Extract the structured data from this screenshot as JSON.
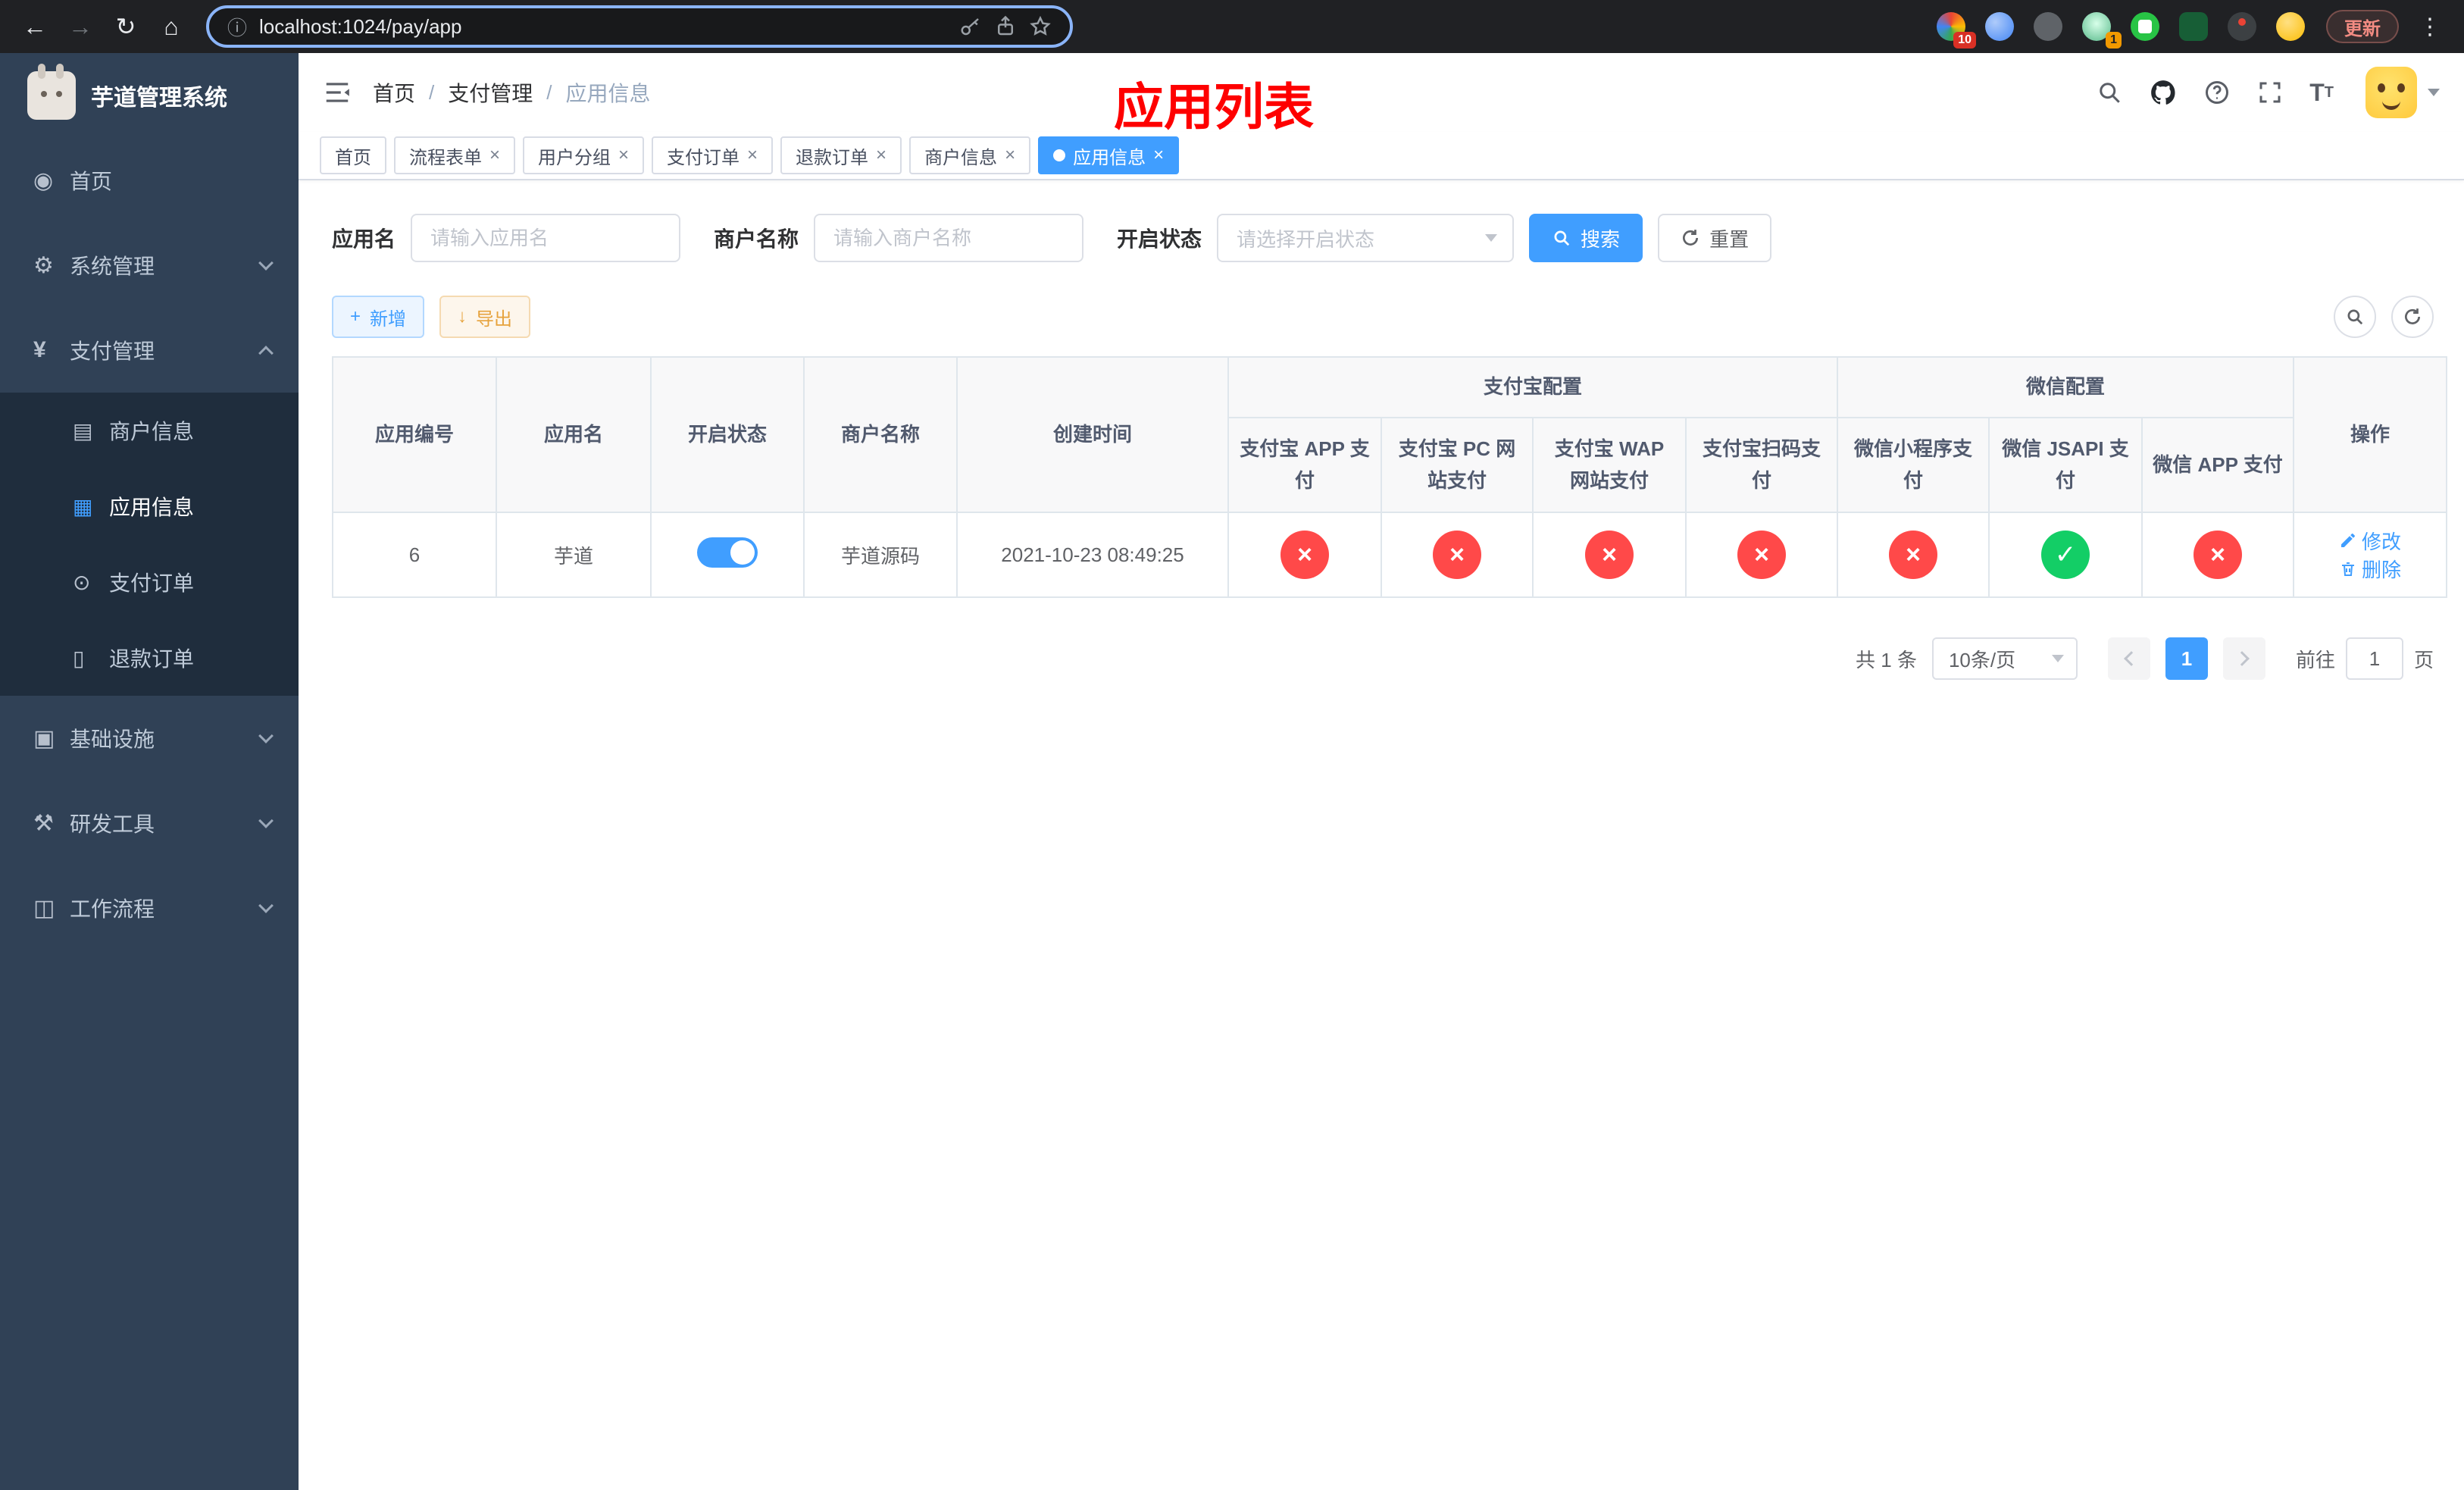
{
  "colors": {
    "primary": "#409eff",
    "success": "#13ce66",
    "danger": "#ff4949",
    "warning": "#e6a23c",
    "sidebar_bg": "#304156",
    "submenu_bg": "#1f2d3d"
  },
  "browser": {
    "url": "localhost:1024/pay/app",
    "update_label": "更新",
    "extension_badge_red": "10",
    "extension_badge_orange": "1"
  },
  "sidebar": {
    "app_title": "芋道管理系统",
    "items": [
      {
        "label": "首页",
        "icon": "dashboard-icon"
      },
      {
        "label": "系统管理",
        "icon": "gear-icon"
      },
      {
        "label": "支付管理",
        "icon": "yen-icon"
      },
      {
        "label": "基础设施",
        "icon": "infrastructure-icon"
      },
      {
        "label": "研发工具",
        "icon": "tools-icon"
      },
      {
        "label": "工作流程",
        "icon": "workflow-icon"
      }
    ],
    "pay_children": [
      {
        "label": "商户信息",
        "icon": "merchant-card-icon"
      },
      {
        "label": "应用信息",
        "icon": "app-grid-icon"
      },
      {
        "label": "支付订单",
        "icon": "pay-order-icon"
      },
      {
        "label": "退款订单",
        "icon": "refund-order-icon"
      }
    ]
  },
  "header": {
    "breadcrumb": [
      "首页",
      "支付管理",
      "应用信息"
    ],
    "annotation": "应用列表"
  },
  "tabs": [
    {
      "label": "首页"
    },
    {
      "label": "流程表单"
    },
    {
      "label": "用户分组"
    },
    {
      "label": "支付订单"
    },
    {
      "label": "退款订单"
    },
    {
      "label": "商户信息"
    },
    {
      "label": "应用信息"
    }
  ],
  "filters": {
    "app_name_label": "应用名",
    "app_name_placeholder": "请输入应用名",
    "merchant_label": "商户名称",
    "merchant_placeholder": "请输入商户名称",
    "status_label": "开启状态",
    "status_placeholder": "请选择开启状态",
    "search_button": "搜索",
    "reset_button": "重置"
  },
  "toolbar": {
    "add_button": "新增",
    "export_button": "导出"
  },
  "table": {
    "columns": {
      "id": "应用编号",
      "name": "应用名",
      "status": "开启状态",
      "merchant": "商户名称",
      "created": "创建时间",
      "alipay_group": "支付宝配置",
      "wechat_group": "微信配置",
      "alipay_app": "支付宝 APP 支付",
      "alipay_pc": "支付宝 PC 网站支付",
      "alipay_wap": "支付宝 WAP 网站支付",
      "alipay_qr": "支付宝扫码支付",
      "wx_mini": "微信小程序支付",
      "wx_jsapi": "微信 JSAPI 支付",
      "wx_app": "微信 APP 支付",
      "actions": "操作"
    },
    "rows": [
      {
        "id": "6",
        "name": "芋道",
        "enabled": true,
        "merchant": "芋道源码",
        "created": "2021-10-23 08:49:25",
        "alipay_app": false,
        "alipay_pc": false,
        "alipay_wap": false,
        "alipay_qr": false,
        "wx_mini": false,
        "wx_jsapi": true,
        "wx_app": false,
        "edit_label": "修改",
        "delete_label": "删除"
      }
    ]
  },
  "pagination": {
    "total_label": "共 1 条",
    "page_size_label": "10条/页",
    "current_page": "1",
    "goto_label": "前往",
    "goto_value": "1",
    "page_unit_label": "页"
  }
}
